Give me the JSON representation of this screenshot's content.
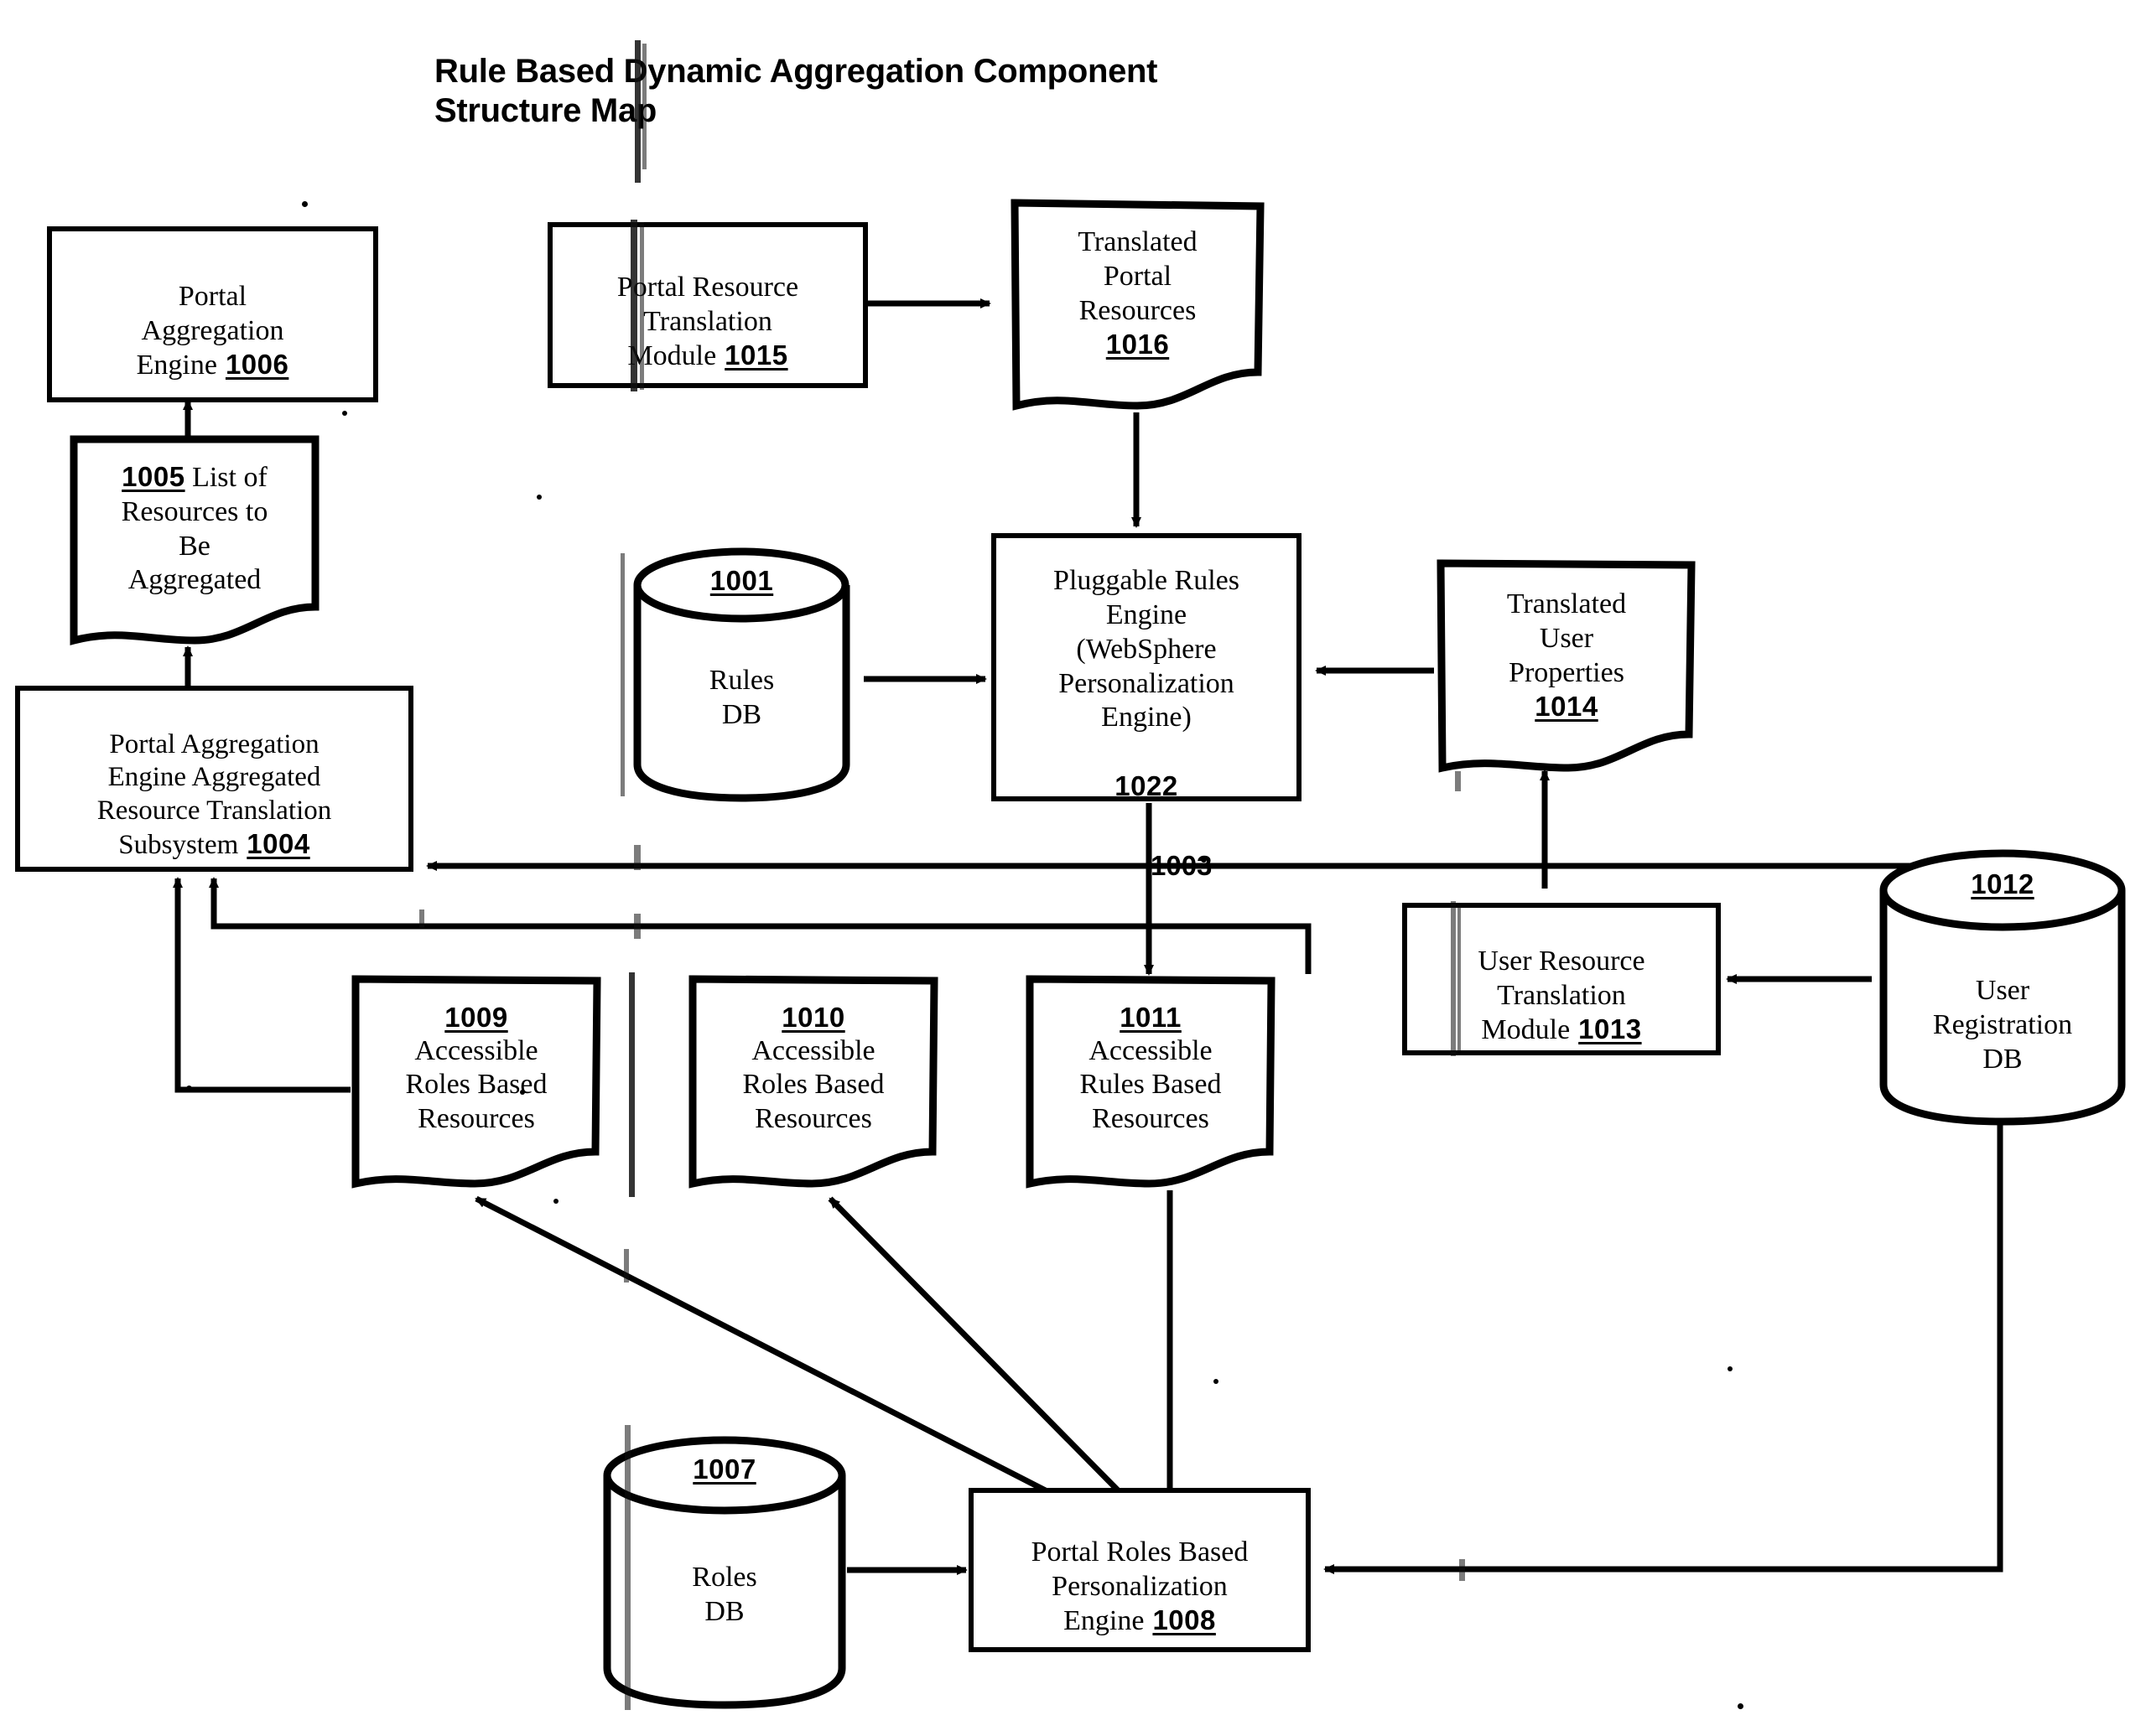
{
  "diagram": {
    "title": "Rule Based Dynamic Aggregation Component\nStructure Map",
    "type": "patent-figure-block-diagram"
  },
  "nodes": {
    "n1006": {
      "label": "Portal\nAggregation\nEngine",
      "ref": "1006",
      "shape": "box"
    },
    "n1005": {
      "label": "List of\nResources to\nBe\nAggregated",
      "ref": "1005",
      "shape": "document"
    },
    "n1004": {
      "label": "Portal Aggregation\nEngine Aggregated\nResource Translation\nSubsystem",
      "ref": "1004",
      "shape": "box"
    },
    "n1015": {
      "label": "Portal Resource\nTranslation\nModule",
      "ref": "1015",
      "shape": "box"
    },
    "n1016": {
      "label": "Translated\nPortal\nResources",
      "ref": "1016",
      "shape": "document"
    },
    "n1001": {
      "label": "Rules\nDB",
      "ref": "1001",
      "shape": "cylinder"
    },
    "n1022": {
      "label": "Pluggable Rules\nEngine\n(WebSphere\nPersonalization\nEngine)",
      "ref": "1022",
      "shape": "box"
    },
    "n1014": {
      "label": "Translated\nUser\nProperties",
      "ref": "1014",
      "shape": "document"
    },
    "n1013": {
      "label": "User Resource\nTranslation\nModule",
      "ref": "1013",
      "shape": "box"
    },
    "n1012": {
      "label": "User\nRegistration\nDB",
      "ref": "1012",
      "shape": "cylinder"
    },
    "n1009": {
      "label": "Accessible\nRoles Based\nResources",
      "ref": "1009",
      "shape": "document"
    },
    "n1010": {
      "label": "Accessible\nRoles Based\nResources",
      "ref": "1010",
      "shape": "document"
    },
    "n1011": {
      "label": "Accessible\nRules Based\nResources",
      "ref": "1011",
      "shape": "document"
    },
    "n1007": {
      "label": "Roles\nDB",
      "ref": "1007",
      "shape": "cylinder"
    },
    "n1008": {
      "label": "Portal Roles Based\nPersonalization\nEngine",
      "ref": "1008",
      "shape": "box"
    }
  },
  "free_labels": {
    "l1003": "1003"
  },
  "colors": {
    "ink": "#000000",
    "paper": "#ffffff"
  }
}
